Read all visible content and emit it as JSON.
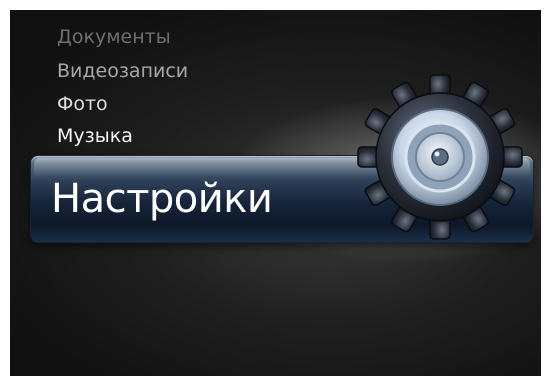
{
  "menu": {
    "items": [
      {
        "label": "Документы"
      },
      {
        "label": "Видеозаписи"
      },
      {
        "label": "Фото"
      },
      {
        "label": "Музыка"
      }
    ],
    "selected": {
      "label": "Настройки"
    }
  },
  "icons": {
    "selected_icon": "gear-icon"
  },
  "colors": {
    "background": "#1e1e1e",
    "selected_bar": "#16243a",
    "text": "#ffffff"
  }
}
